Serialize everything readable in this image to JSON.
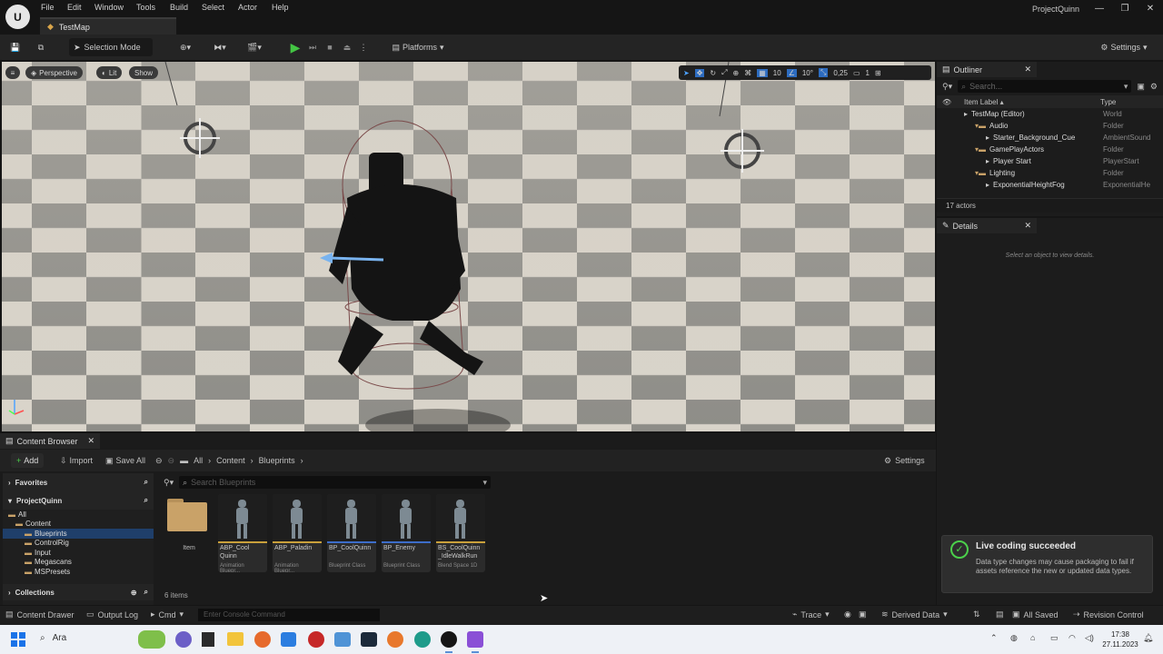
{
  "titlebar": {
    "menu": [
      "File",
      "Edit",
      "Window",
      "Tools",
      "Build",
      "Select",
      "Actor",
      "Help"
    ],
    "map_tab": "TestMap",
    "project_name": "ProjectQuinn"
  },
  "toolbar": {
    "selection_mode": "Selection Mode",
    "platforms": "Platforms",
    "settings": "Settings"
  },
  "viewport": {
    "perspective": "Perspective",
    "lit": "Lit",
    "show": "Show",
    "snap_grid": "10",
    "snap_rot": "10°",
    "snap_scale": "0,25",
    "camera_speed": "1"
  },
  "outliner": {
    "title": "Outliner",
    "search_placeholder": "Search...",
    "col_label": "Item Label ▴",
    "col_type": "Type",
    "rows": [
      {
        "label": "TestMap (Editor)",
        "type": "World",
        "indent": 30
      },
      {
        "label": "Audio",
        "type": "Folder",
        "indent": 42
      },
      {
        "label": "Starter_Background_Cue",
        "type": "AmbientSound",
        "indent": 54
      },
      {
        "label": "GamePlayActors",
        "type": "Folder",
        "indent": 42
      },
      {
        "label": "Player Start",
        "type": "PlayerStart",
        "indent": 54
      },
      {
        "label": "Lighting",
        "type": "Folder",
        "indent": 42
      },
      {
        "label": "ExponentialHeightFog",
        "type": "ExponentialHe",
        "indent": 54
      }
    ],
    "actor_count": "17 actors"
  },
  "details": {
    "title": "Details",
    "empty_msg": "Select an object to view details."
  },
  "content_browser": {
    "tab": "Content Browser",
    "add": "Add",
    "import": "Import",
    "save_all": "Save All",
    "breadcrumb": [
      "All",
      "Content",
      "Blueprints"
    ],
    "settings": "Settings",
    "favorites": "Favorites",
    "project": "ProjectQuinn",
    "tree": [
      {
        "label": "All",
        "indent": 6,
        "selected": false
      },
      {
        "label": "Content",
        "indent": 14,
        "selected": false
      },
      {
        "label": "Blueprints",
        "indent": 24,
        "selected": true
      },
      {
        "label": "ControlRig",
        "indent": 24,
        "selected": false
      },
      {
        "label": "Input",
        "indent": 24,
        "selected": false
      },
      {
        "label": "Megascans",
        "indent": 24,
        "selected": false
      },
      {
        "label": "MSPresets",
        "indent": 24,
        "selected": false
      }
    ],
    "collections": "Collections",
    "search_placeholder": "Search Blueprints",
    "folder_label": "Item",
    "assets": [
      {
        "name": "ABP_Cool Quinn",
        "type": "Animation Bluepr...",
        "color": "#c9a03b"
      },
      {
        "name": "ABP_Paladin",
        "type": "Animation Bluepr...",
        "color": "#c9a03b"
      },
      {
        "name": "BP_CoolQuinn",
        "type": "Blueprint Class",
        "color": "#3d6dc9"
      },
      {
        "name": "BP_Enemy",
        "type": "Blueprint Class",
        "color": "#3d6dc9"
      },
      {
        "name": "BS_CoolQuinn _IdleWalkRun",
        "type": "Blend Space 1D",
        "color": "#c9a03b"
      }
    ],
    "item_count": "6 items"
  },
  "statusbar": {
    "content_drawer": "Content Drawer",
    "output_log": "Output Log",
    "cmd": "Cmd",
    "console_placeholder": "Enter Console Command",
    "trace": "Trace",
    "derived_data": "Derived Data",
    "all_saved": "All Saved",
    "revision_control": "Revision Control"
  },
  "toast": {
    "title": "Live coding succeeded",
    "body": "Data type changes may cause packaging to fail if assets reference the new or updated data types."
  },
  "taskbar": {
    "search": "Ara",
    "time": "17:38",
    "date": "27.11.2023"
  }
}
